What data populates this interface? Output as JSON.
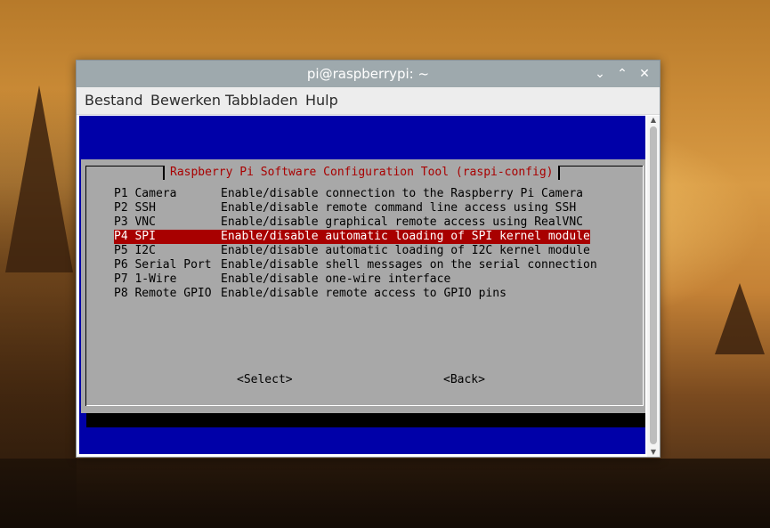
{
  "window": {
    "title": "pi@raspberrypi: ~",
    "minimize_icon": "chevron-down-icon",
    "maximize_icon": "chevron-up-icon",
    "close_icon": "close-icon"
  },
  "menubar": {
    "items": [
      "Bestand",
      "Bewerken",
      "Tabbladen",
      "Hulp"
    ]
  },
  "dialog": {
    "title": "Raspberry Pi Software Configuration Tool (raspi-config)",
    "options": [
      {
        "key": "P1 Camera",
        "desc": "Enable/disable connection to the Raspberry Pi Camera"
      },
      {
        "key": "P2 SSH",
        "desc": "Enable/disable remote command line access using SSH"
      },
      {
        "key": "P3 VNC",
        "desc": "Enable/disable graphical remote access using RealVNC"
      },
      {
        "key": "P4 SPI",
        "desc": "Enable/disable automatic loading of SPI kernel module"
      },
      {
        "key": "P5 I2C",
        "desc": "Enable/disable automatic loading of I2C kernel module"
      },
      {
        "key": "P6 Serial Port",
        "desc": "Enable/disable shell messages on the serial connection"
      },
      {
        "key": "P7 1-Wire",
        "desc": "Enable/disable one-wire interface"
      },
      {
        "key": "P8 Remote GPIO",
        "desc": "Enable/disable remote access to GPIO pins"
      }
    ],
    "selected_index": 3,
    "select_button": "<Select>",
    "back_button": "<Back>"
  },
  "colors": {
    "terminal_bg": "#0000a8",
    "dialog_bg": "#a8a8a8",
    "title_text": "#a80000",
    "selection_bg": "#a80000"
  }
}
